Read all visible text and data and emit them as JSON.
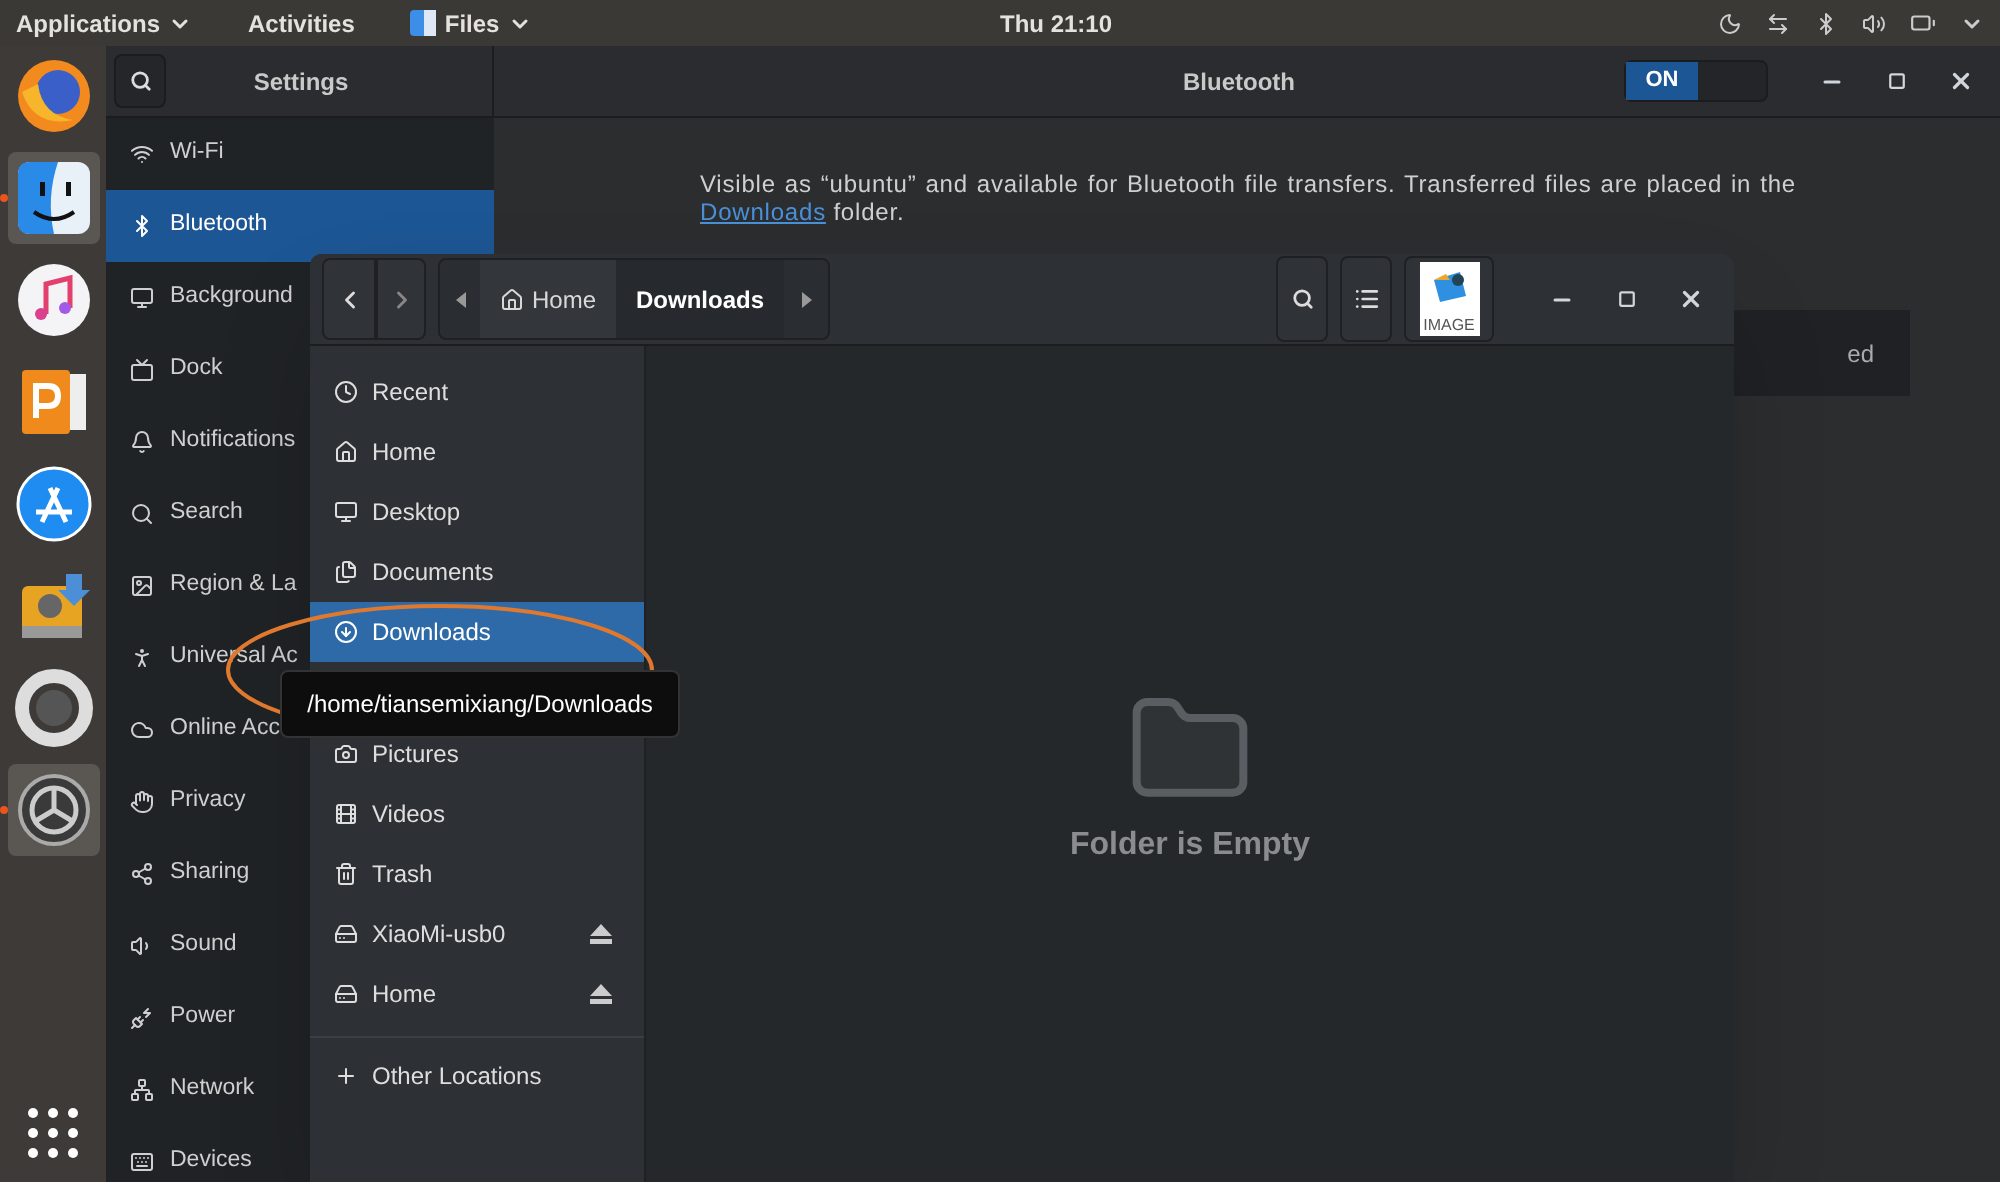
{
  "top_bar": {
    "menus": [
      {
        "label": "Applications",
        "kind": "menu"
      },
      {
        "label": "Activities",
        "kind": "plain"
      },
      {
        "label": "Files",
        "kind": "app"
      }
    ],
    "clock": "Thu 21:10"
  },
  "dock": [
    {
      "kind": "browser",
      "selected": false,
      "running": false
    },
    {
      "kind": "finder",
      "selected": true,
      "running": true
    },
    {
      "kind": "music",
      "selected": false,
      "running": false
    },
    {
      "kind": "slides",
      "selected": false,
      "running": false
    },
    {
      "kind": "store",
      "selected": false,
      "running": false
    },
    {
      "kind": "drive",
      "selected": false,
      "running": false
    },
    {
      "kind": "help",
      "selected": false,
      "running": false
    },
    {
      "kind": "settings",
      "selected": true,
      "running": true
    }
  ],
  "settings": {
    "title": "Settings",
    "page_title": "Bluetooth",
    "switch": {
      "label": "ON",
      "on": true
    },
    "sidebar": [
      {
        "kind": "wifi",
        "label": "Wi-Fi",
        "selected": false
      },
      {
        "kind": "bluetooth",
        "label": "Bluetooth",
        "selected": true
      },
      {
        "kind": "background",
        "label": "Background",
        "selected": false
      },
      {
        "kind": "dock",
        "label": "Dock",
        "selected": false
      },
      {
        "kind": "notifications",
        "label": "Notifications",
        "selected": false
      },
      {
        "kind": "search",
        "label": "Search",
        "selected": false
      },
      {
        "kind": "region",
        "label": "Region & La",
        "selected": false
      },
      {
        "kind": "access",
        "label": "Universal Ac",
        "selected": false
      },
      {
        "kind": "online",
        "label": "Online Acc",
        "selected": false
      },
      {
        "kind": "privacy",
        "label": "Privacy",
        "selected": false
      },
      {
        "kind": "sharing",
        "label": "Sharing",
        "selected": false
      },
      {
        "kind": "sound",
        "label": "Sound",
        "selected": false
      },
      {
        "kind": "power",
        "label": "Power",
        "selected": false
      },
      {
        "kind": "network",
        "label": "Network",
        "selected": false
      },
      {
        "kind": "devices",
        "label": "Devices",
        "selected": false
      }
    ],
    "description": {
      "text": "Visible as “ubuntu” and available for Bluetooth file transfers. Transferred files are placed in the",
      "link": "Downloads",
      "after": "folder."
    },
    "panel_text": "ed"
  },
  "files": {
    "path": [
      {
        "kind": "home",
        "label": "Home",
        "selected": false
      },
      {
        "kind": "folder",
        "label": "Downloads",
        "selected": true
      }
    ],
    "thumbnail_label": "IMAGE",
    "places": [
      {
        "kind": "recent",
        "label": "Recent",
        "selected": false,
        "eject": false
      },
      {
        "kind": "home",
        "label": "Home",
        "selected": false,
        "eject": false
      },
      {
        "kind": "desktop",
        "label": "Desktop",
        "selected": false,
        "eject": false
      },
      {
        "kind": "documents",
        "label": "Documents",
        "selected": false,
        "eject": false
      },
      {
        "kind": "downloads",
        "label": "Downloads",
        "selected": true,
        "eject": false
      },
      {
        "kind": "pictures",
        "label": "Pictures",
        "selected": false,
        "eject": false
      },
      {
        "kind": "videos",
        "label": "Videos",
        "selected": false,
        "eject": false
      },
      {
        "kind": "trash",
        "label": "Trash",
        "selected": false,
        "eject": false
      },
      {
        "kind": "drive",
        "label": "XiaoMi-usb0",
        "selected": false,
        "eject": true
      },
      {
        "kind": "drive",
        "label": "Home",
        "selected": false,
        "eject": true
      }
    ],
    "other_locations": "Other Locations",
    "tooltip": "/home/tiansemixiang/Downloads",
    "empty_message": "Folder is Empty"
  }
}
